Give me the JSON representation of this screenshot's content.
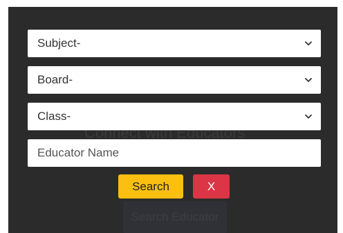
{
  "background": {
    "heading": "Connect with Educators",
    "button_label": "Search Educator"
  },
  "filters": {
    "subject_label": "Subject-",
    "board_label": "Board-",
    "class_label": "Class-",
    "educator_placeholder": "Educator Name"
  },
  "actions": {
    "search_label": "Search",
    "close_label": "X"
  },
  "icons": {
    "dropdown": "chevron-down-icon"
  },
  "colors": {
    "overlay": "#2b2b2b",
    "search_button": "#fbbf11",
    "close_button": "#dc3545"
  }
}
